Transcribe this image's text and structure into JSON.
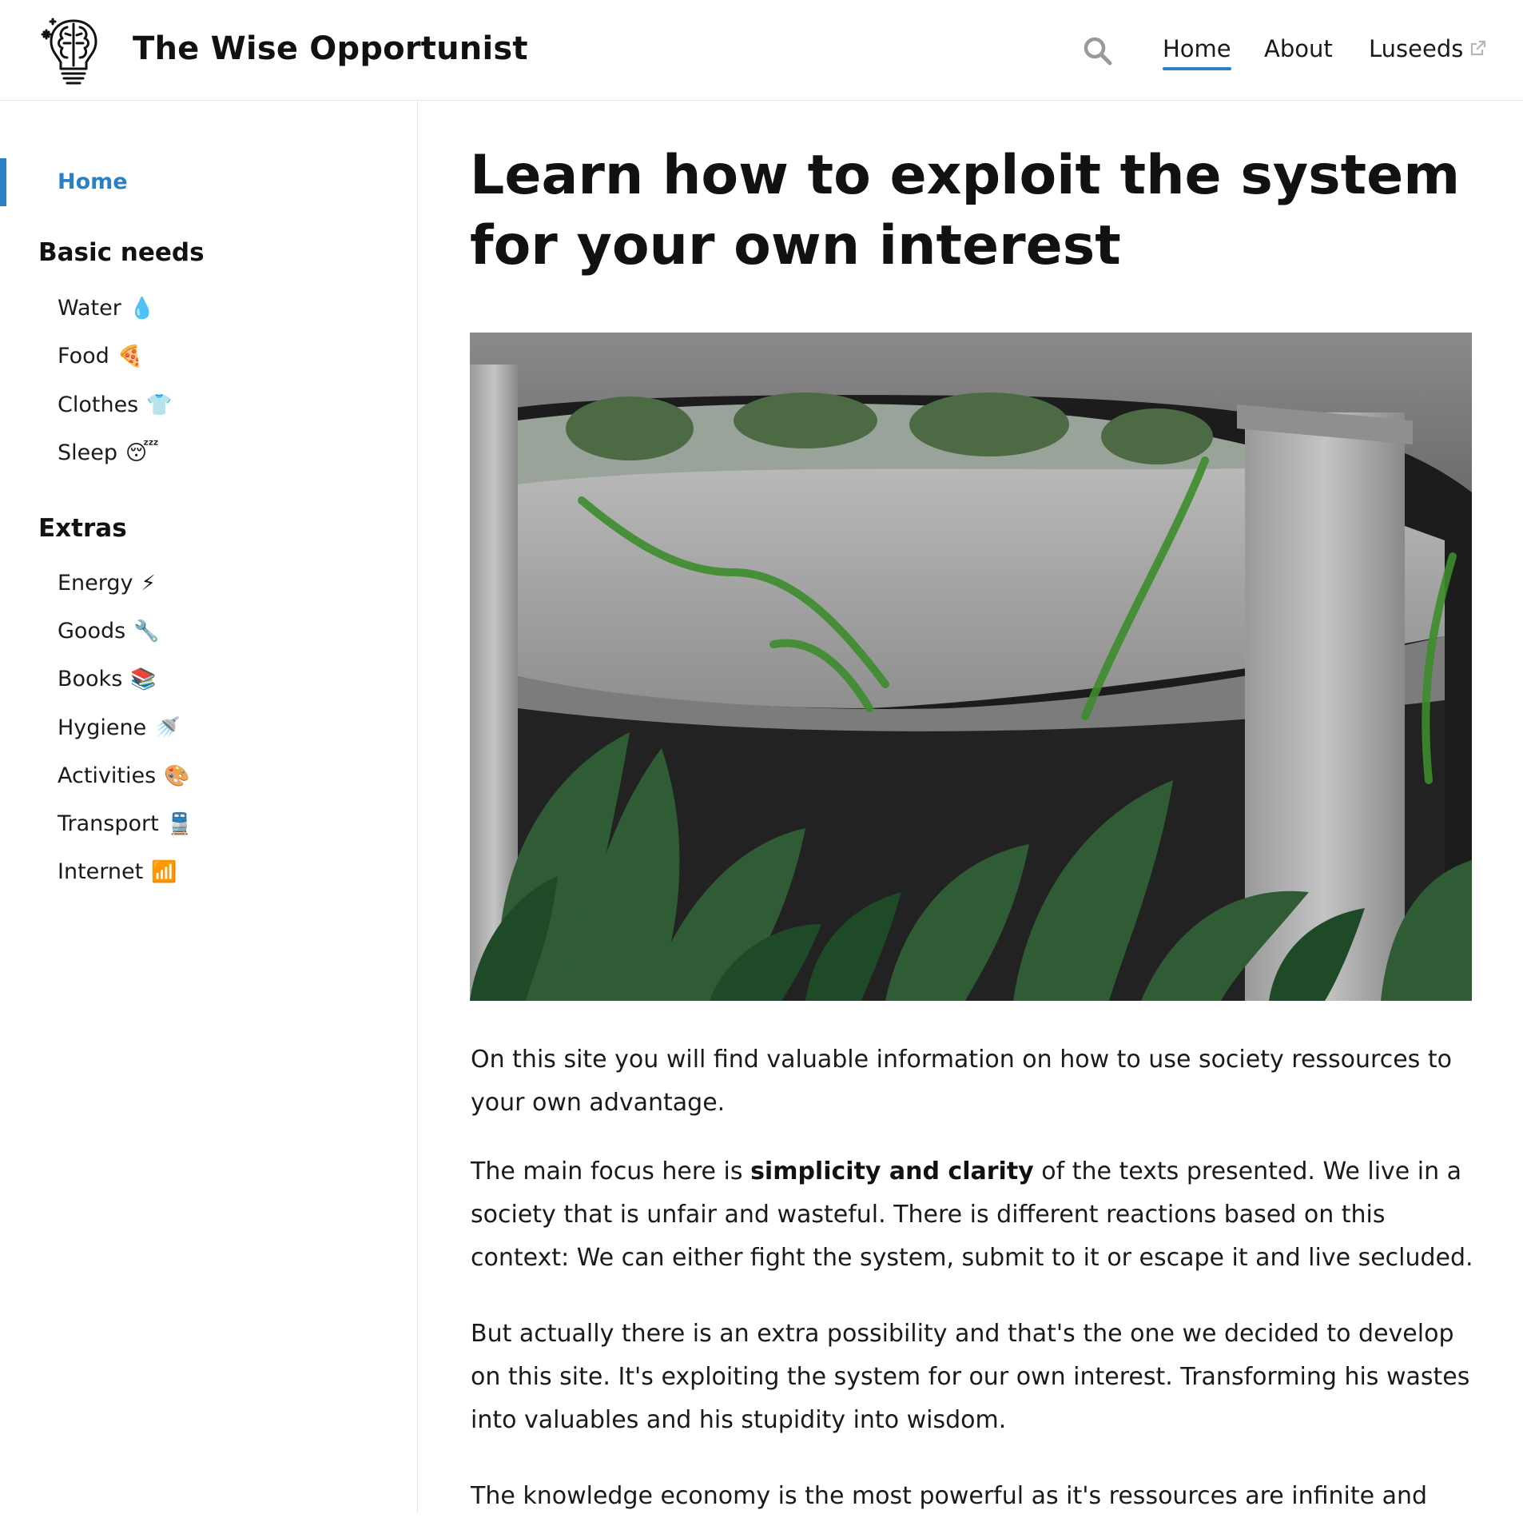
{
  "header": {
    "site_title": "The Wise Opportunist",
    "nav": {
      "home": "Home",
      "about": "About",
      "luseeds": "Luseeds"
    }
  },
  "sidebar": {
    "home": "Home",
    "sections": [
      {
        "title": "Basic needs",
        "items": [
          {
            "label": "Water",
            "emoji": "💧"
          },
          {
            "label": "Food",
            "emoji": "🍕"
          },
          {
            "label": "Clothes",
            "emoji": "👕"
          },
          {
            "label": "Sleep",
            "emoji": "😴"
          }
        ]
      },
      {
        "title": "Extras",
        "items": [
          {
            "label": "Energy",
            "emoji": "⚡"
          },
          {
            "label": "Goods",
            "emoji": "🔧"
          },
          {
            "label": "Books",
            "emoji": "📚"
          },
          {
            "label": "Hygiene",
            "emoji": "🚿"
          },
          {
            "label": "Activities",
            "emoji": "🎨"
          },
          {
            "label": "Transport",
            "emoji": "🚆"
          },
          {
            "label": "Internet",
            "emoji": "📶"
          }
        ]
      }
    ]
  },
  "main": {
    "title": "Learn how to exploit the system for your own interest",
    "p1": "On this site you will find valuable information on how to use society ressources to your own advantage.",
    "p2_before": "The main focus here is ",
    "p2_bold": "simplicity and clarity",
    "p2_after": " of the texts presented. We live in a society that is unfair and wasteful. There is different reactions based on this context: We can either fight the system, submit to it or escape it and live secluded.",
    "p3": "But actually there is an extra possibility and that's the one we decided to develop on this site. It's exploiting the system for our own interest. Transforming his wastes into valuables and his stupidity into wisdom.",
    "p4": "The knowledge economy is the most powerful as it's ressources are infinite and"
  },
  "colors": {
    "accent": "#2b80c5",
    "text": "#1a1a1a",
    "border": "#e6e6e6"
  },
  "icons": {
    "logo": "brain-lightbulb-icon",
    "search": "search-icon",
    "external": "external-link-icon"
  }
}
